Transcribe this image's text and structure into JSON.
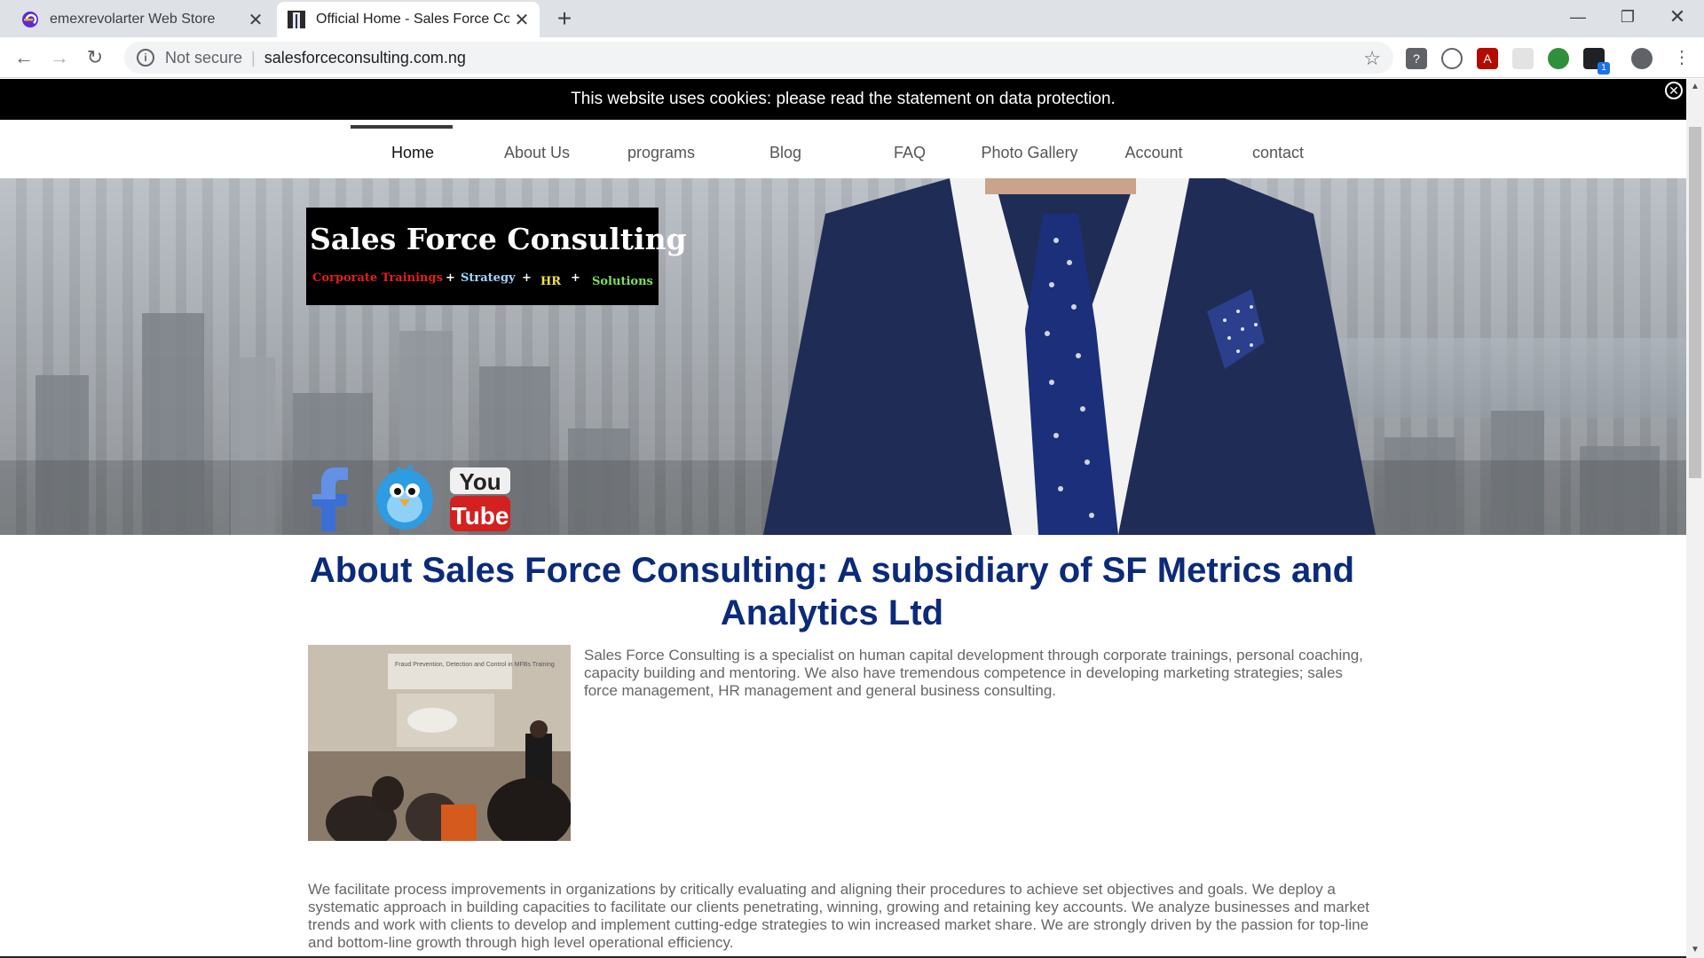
{
  "browser": {
    "tabs": [
      {
        "title": "emexrevolarter Web Store",
        "active": false
      },
      {
        "title": "Official Home - Sales Force Cons",
        "active": true
      }
    ],
    "new_tab_icon": "plus-icon",
    "window_controls": [
      "minimize-icon",
      "restore-icon",
      "close-icon"
    ],
    "security_label": "Not secure",
    "url": "salesforceconsulting.com.ng",
    "extension_badge": "1"
  },
  "cookie_notice": {
    "text": "This website uses cookies: please read the statement on data protection.",
    "close_icon": "close-circle-icon"
  },
  "nav": {
    "items": [
      {
        "label": "Home",
        "active": true
      },
      {
        "label": "About Us",
        "active": false
      },
      {
        "label": "programs",
        "active": false
      },
      {
        "label": "Blog",
        "active": false
      },
      {
        "label": "FAQ",
        "active": false
      },
      {
        "label": "Photo Gallery",
        "active": false
      },
      {
        "label": "Account",
        "active": false
      },
      {
        "label": "contact",
        "active": false
      }
    ]
  },
  "logo": {
    "title": "Sales Force Consulting",
    "tagline": [
      {
        "text": "Corporate Trainings",
        "color": "#e0201c"
      },
      {
        "text": "+",
        "color": "#ffffff"
      },
      {
        "text": "Strategy",
        "color": "#9fd6ff"
      },
      {
        "text": "+",
        "color": "#ffffff"
      },
      {
        "text": "HR",
        "color": "#f2e34a"
      },
      {
        "text": "+",
        "color": "#ffffff"
      },
      {
        "text": "Solutions",
        "color": "#7be05a"
      }
    ]
  },
  "social": {
    "facebook": "facebook-icon",
    "twitter": "twitter-icon",
    "youtube": {
      "icon": "youtube-icon",
      "line1": "You",
      "line2": "Tube"
    }
  },
  "about": {
    "heading": "About Sales Force Consulting: A subsidiary of SF Metrics and Analytics Ltd",
    "photo_caption": "Fraud Prevention, Detection and Control in MFBs Training",
    "intro": "Sales Force Consulting is a specialist on human capital development through corporate trainings, personal coaching, capacity building and mentoring. We also have tremendous competence in developing marketing strategies; sales force management, HR management and general business consulting.",
    "body": "We facilitate process improvements in organizations by critically evaluating and aligning their procedures to achieve set objectives and goals. We deploy a systematic approach in building capacities to facilitate our clients penetrating, winning, growing and retaining key accounts. We analyze businesses and market trends and work with clients to develop and implement cutting-edge strategies to win increased market share. We are strongly driven by the passion for top-line and bottom-line growth through high level operational efficiency."
  },
  "colors": {
    "heading": "#0b2a7a",
    "body_text": "#666666",
    "cookie_bar": "#000000"
  }
}
